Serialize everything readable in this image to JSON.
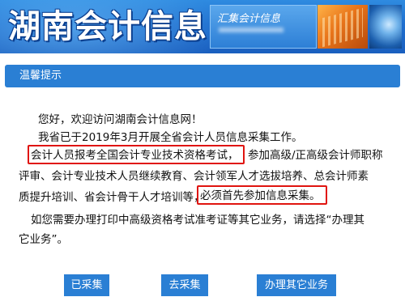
{
  "header": {
    "site_title": "湖南会计信息",
    "subtitle": "汇集会计信息"
  },
  "notice": {
    "title": "温馨提示",
    "greeting": "您好，欢迎访问湖南会计信息网！",
    "line1": "我省已于2019年3月开展全省会计人员信息采集工作。",
    "line2_highlight": "会计人员报考全国会计专业技术资格考试，",
    "line2_rest": "参加高级/正高级会计师职称",
    "line3": "评审、会计专业技术人员继续教育、会计领军人才选拔培养、总会计师素",
    "line4_start": "质提升培训、省会计骨干人才培训等，",
    "line4_highlight": "必须首先参加信息采集。",
    "line5": "如您需要办理打印中高级资格考试准考证等其它业务，请选择“办理其",
    "line6": "它业务”。"
  },
  "buttons": {
    "collected": "已采集",
    "go_collect": "去采集",
    "other_business": "办理其它业务"
  },
  "colors": {
    "accent": "#2a7fd4",
    "highlight_border": "#e0140f"
  }
}
